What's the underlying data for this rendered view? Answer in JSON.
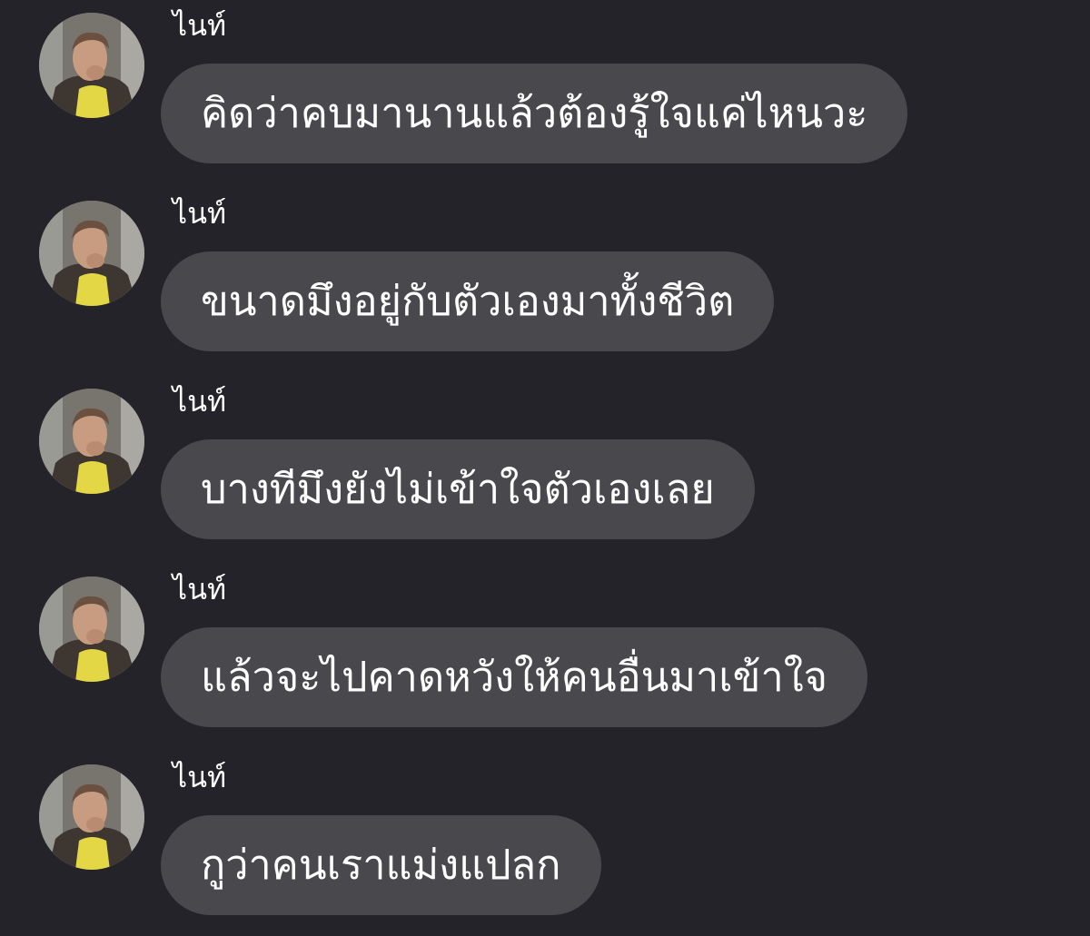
{
  "conversation": {
    "messages": [
      {
        "sender": "ไนท์",
        "text": "คิดว่าคบมานานแล้วต้องรู้ใจแค่ไหนวะ"
      },
      {
        "sender": "ไนท์",
        "text": "ขนาดมึงอยู่กับตัวเองมาทั้งชีวิต"
      },
      {
        "sender": "ไนท์",
        "text": "บางทีมึงยังไม่เข้าใจตัวเองเลย"
      },
      {
        "sender": "ไนท์",
        "text": "แล้วจะไปคาดหวังให้คนอื่นมาเข้าใจ"
      },
      {
        "sender": "ไนท์",
        "text": "กูว่าคนเราแม่งแปลก"
      }
    ]
  },
  "theme": {
    "background": "#232329",
    "bubble": "#48484d",
    "text": "#ffffff"
  }
}
